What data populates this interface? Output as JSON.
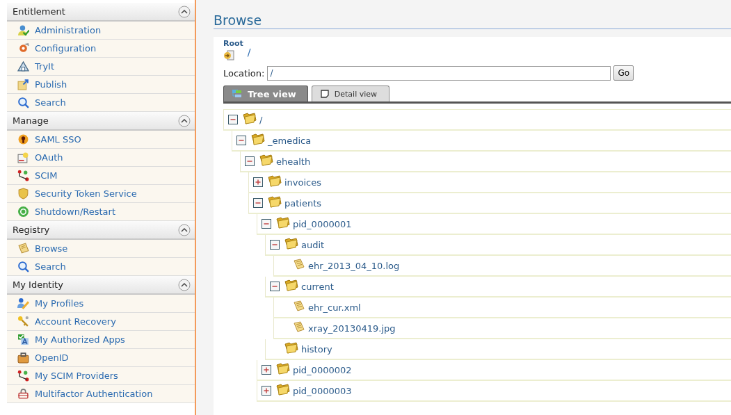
{
  "sidebar": {
    "sections": [
      {
        "title": "Entitlement",
        "expanded": true,
        "items": [
          {
            "label": "Administration"
          },
          {
            "label": "Configuration"
          },
          {
            "label": "TryIt"
          },
          {
            "label": "Publish"
          },
          {
            "label": "Search"
          }
        ]
      },
      {
        "title": "Manage",
        "expanded": true,
        "items": [
          {
            "label": "SAML SSO"
          },
          {
            "label": "OAuth"
          },
          {
            "label": "SCIM"
          },
          {
            "label": "Security Token Service"
          },
          {
            "label": "Shutdown/Restart"
          }
        ]
      },
      {
        "title": "Registry",
        "expanded": true,
        "items": [
          {
            "label": "Browse"
          },
          {
            "label": "Search"
          }
        ]
      },
      {
        "title": "My Identity",
        "expanded": true,
        "items": [
          {
            "label": "My Profiles"
          },
          {
            "label": "Account Recovery"
          },
          {
            "label": "My Authorized Apps"
          },
          {
            "label": "OpenID"
          },
          {
            "label": "My SCIM Providers"
          },
          {
            "label": "Multifactor Authentication"
          }
        ]
      }
    ]
  },
  "page": {
    "title": "Browse",
    "root_label": "Root",
    "root_path": "/",
    "location_label": "Location:",
    "location_value": "/",
    "go_button": "Go",
    "tabs": [
      {
        "label": "Tree view",
        "selected": true
      },
      {
        "label": "Detail view",
        "selected": false
      }
    ],
    "tree": [
      {
        "name": "/",
        "kind": "folder",
        "expanded": true,
        "children": [
          {
            "name": "_emedica",
            "kind": "folder",
            "expanded": true,
            "children": [
              {
                "name": "ehealth",
                "kind": "folder",
                "expanded": true,
                "children": [
                  {
                    "name": "invoices",
                    "kind": "folder",
                    "expanded": false
                  },
                  {
                    "name": "patients",
                    "kind": "folder",
                    "expanded": true,
                    "children": [
                      {
                        "name": "pid_0000001",
                        "kind": "folder",
                        "expanded": true,
                        "children": [
                          {
                            "name": "audit",
                            "kind": "folder",
                            "expanded": true,
                            "children": [
                              {
                                "name": "ehr_2013_04_10.log",
                                "kind": "file"
                              }
                            ]
                          },
                          {
                            "name": "current",
                            "kind": "folder",
                            "expanded": true,
                            "children": [
                              {
                                "name": "ehr_cur.xml",
                                "kind": "file"
                              },
                              {
                                "name": "xray_20130419.jpg",
                                "kind": "file"
                              }
                            ]
                          },
                          {
                            "name": "history",
                            "kind": "folder"
                          }
                        ]
                      },
                      {
                        "name": "pid_0000002",
                        "kind": "folder",
                        "expanded": false
                      },
                      {
                        "name": "pid_0000003",
                        "kind": "folder",
                        "expanded": false
                      }
                    ]
                  }
                ]
              }
            ]
          }
        ]
      }
    ]
  }
}
